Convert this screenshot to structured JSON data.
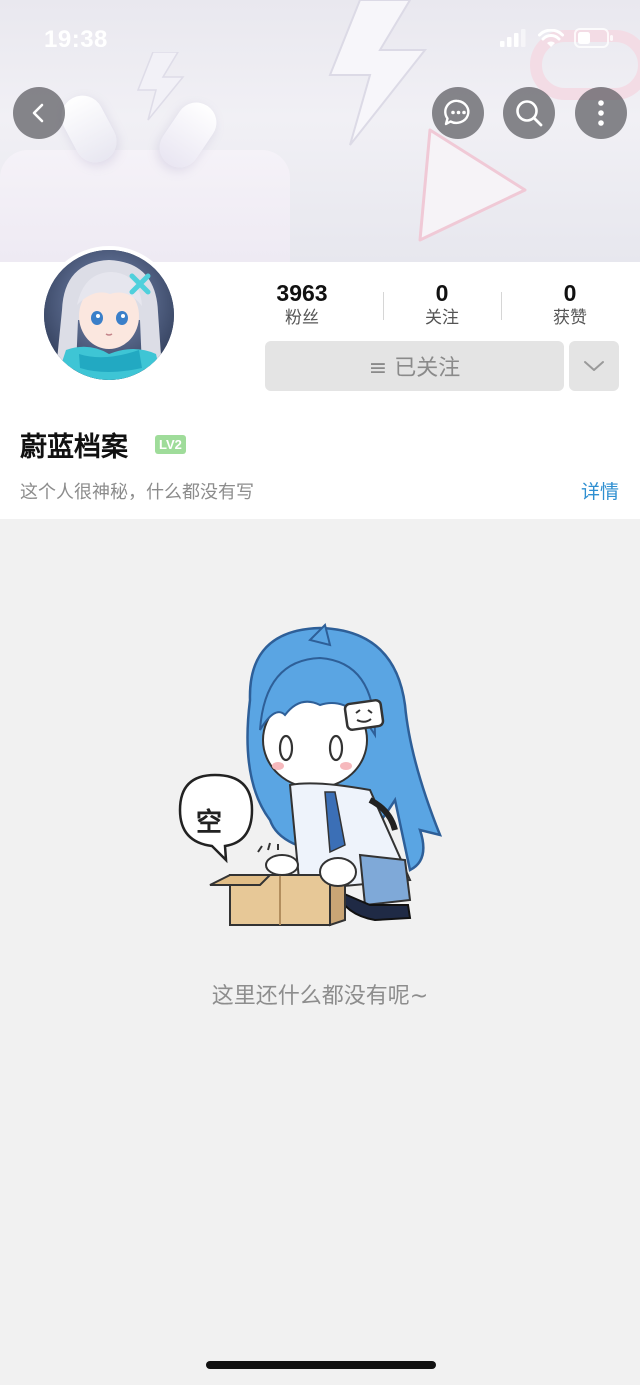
{
  "status_bar": {
    "time": "19:38"
  },
  "nav": {
    "back_icon": "chevron-left-icon",
    "message_icon": "chat-bubble-icon",
    "search_icon": "search-icon",
    "more_icon": "vertical-dots-icon"
  },
  "profile": {
    "stats": [
      {
        "value": "3963",
        "label": "粉丝"
      },
      {
        "value": "0",
        "label": "关注"
      },
      {
        "value": "0",
        "label": "获赞"
      }
    ],
    "follow_button_label": "≡ 已关注",
    "username": "蔚蓝档案",
    "level": "LV2",
    "bio": "这个人很神秘，什么都没有写",
    "details_link": "详情"
  },
  "empty_state": {
    "bubble_text": "空",
    "message": "这里还什么都没有呢~"
  },
  "colors": {
    "accent_link": "#2f8fd1",
    "level_badge": "#9fdc9a",
    "page_background": "#f1f1f1"
  }
}
